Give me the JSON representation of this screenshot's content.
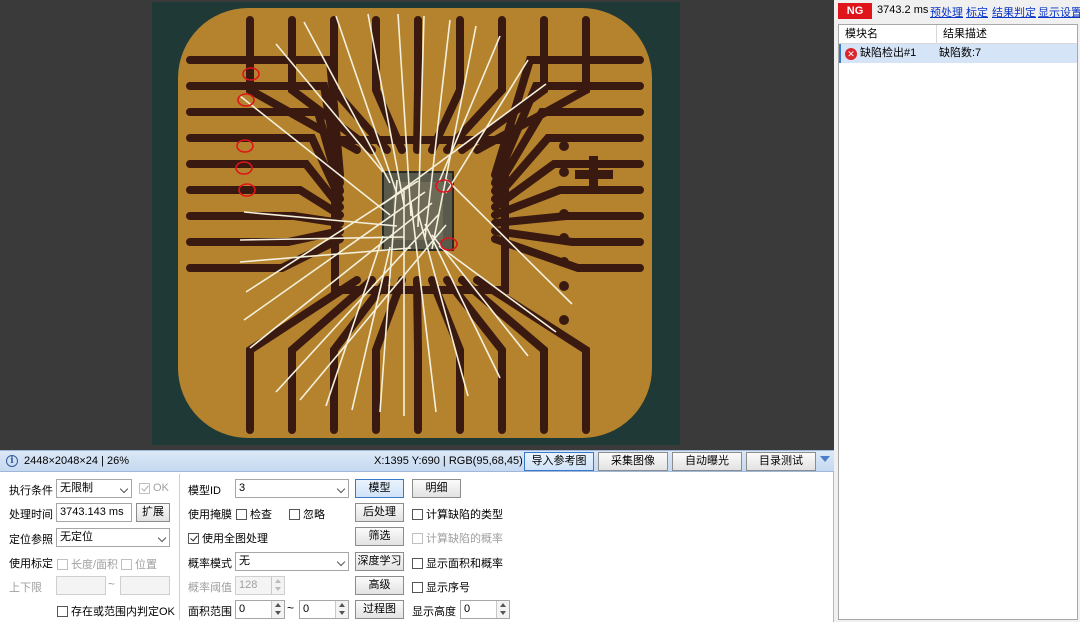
{
  "viewer": {
    "image_info": "2448×2048×24 | 26%",
    "pixel_readout": "X:1395 Y:690 | RGB(95,68,45)",
    "buttons": [
      {
        "label": "导入参考图",
        "active": true
      },
      {
        "label": "采集图像",
        "active": false
      },
      {
        "label": "自动曝光",
        "active": false
      },
      {
        "label": "目录测试",
        "active": false
      }
    ]
  },
  "settings": {
    "exec_condition": {
      "label": "执行条件",
      "value": "无限制",
      "ok_label": "OK",
      "ok_checked": true
    },
    "process_time": {
      "label": "处理时间",
      "value": "3743.143 ms",
      "expand_label": "扩展"
    },
    "position_ref": {
      "label": "定位参照",
      "value": "无定位"
    },
    "calibration": {
      "label": "使用标定",
      "length_area": "长度/面积",
      "position": "位置"
    },
    "limits": {
      "label": "上下限",
      "tilde": "~"
    },
    "range_ok": {
      "label": "存在或范围内判定OK"
    },
    "model_id": {
      "label": "模型ID",
      "value": "3",
      "model_button": "模型",
      "detail_button": "明细"
    },
    "use_mask": {
      "label": "使用掩膜",
      "check_label": "检查",
      "ignore_label": "忽略",
      "post_button": "后处理",
      "calc_type": "计算缺陷的类型"
    },
    "full_image": {
      "label": "使用全图处理",
      "checked": true,
      "filter_button": "筛选",
      "calc_prob": "计算缺陷的概率"
    },
    "prob_mode": {
      "label": "概率模式",
      "value": "无",
      "deep_button": "深度学习",
      "show_area": "显示面积和概率"
    },
    "prob_threshold": {
      "label": "概率阈值",
      "value": "128",
      "advanced_button": "高级",
      "show_index": "显示序号"
    },
    "area_range": {
      "label": "面积范围",
      "min": "0",
      "tilde": "~",
      "max": "0",
      "process_button": "过程图",
      "display_height_label": "显示高度",
      "display_height": "0"
    }
  },
  "results": {
    "status": "NG",
    "time": "3743.2 ms",
    "links": [
      "预处理",
      "标定",
      "结果判定",
      "显示设置"
    ],
    "columns": [
      "模块名",
      "结果描述"
    ],
    "rows": [
      {
        "name": "缺陷检出#1",
        "desc": "缺陷数:7"
      }
    ]
  },
  "colors": {
    "ng_red": "#e0141b",
    "link_blue": "#0a35c8",
    "selection": "#d5e4f7",
    "copper": "#b5832d",
    "dark_trace": "#3a1a10",
    "wire": "#f4f0dc"
  }
}
